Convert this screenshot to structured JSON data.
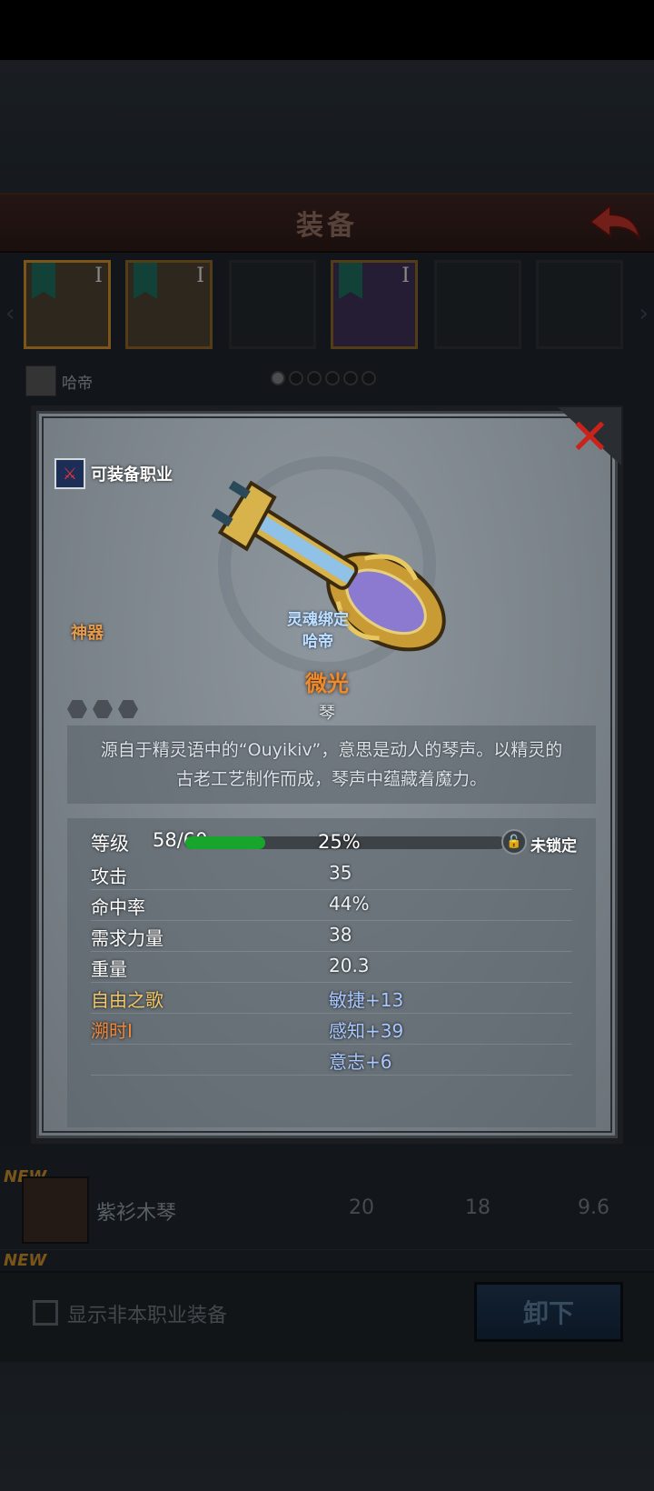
{
  "screen": {
    "title": "装备",
    "owner_name": "哈帝",
    "slots": [
      {
        "tier": "I",
        "state": "active"
      },
      {
        "tier": "I",
        "state": "gold"
      },
      {
        "tier": "",
        "state": "empty"
      },
      {
        "tier": "I",
        "state": "purple"
      },
      {
        "tier": "",
        "state": "empty"
      },
      {
        "tier": "",
        "state": "empty"
      }
    ],
    "page_dots": 6,
    "active_dot": 0
  },
  "item": {
    "class_label": "可装备职业",
    "rarity": "神器",
    "bound_line1": "灵魂绑定",
    "bound_line2": "哈帝",
    "name": "微光",
    "type": "琴",
    "description": "源自于精灵语中的“Ouyikiv”，意思是动人的琴声。以精灵的古老工艺制作而成，琴声中蕴藏着魔力。",
    "level_label": "等级",
    "level_value": "58/60",
    "level_progress": 0.25,
    "level_pct": "25%",
    "lock_label": "未锁定",
    "stats": [
      {
        "name": "攻击",
        "value": "35"
      },
      {
        "name": "命中率",
        "value": "44%"
      },
      {
        "name": "需求力量",
        "value": "38"
      },
      {
        "name": "重量",
        "value": "20.3"
      }
    ],
    "bonus_name_1": "自由之歌",
    "bonus_name_2": "溯时I",
    "bonus_1": "敏捷+13",
    "bonus_2": "感知+39",
    "bonus_3": "意志+6"
  },
  "list": {
    "new_tag": "NEW",
    "row_name": "紫衫木琴",
    "row_v1": "20",
    "row_v2": "18",
    "row_v3": "9.6"
  },
  "bottom": {
    "show_other_class": "显示非本职业装备",
    "unequip": "卸下"
  },
  "colors": {
    "accent_orange": "#f08a2a",
    "bonus_blue": "#a9c8ff",
    "progress_green": "#17a52b",
    "close_red": "#c9231b"
  }
}
